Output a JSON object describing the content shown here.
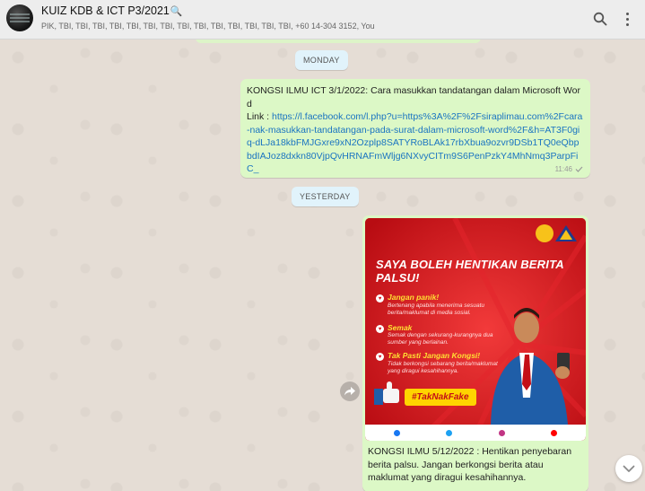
{
  "header": {
    "title": "KUIZ KDB & ICT P3/2021",
    "participants": "PIK, TBI, TBI, TBI, TBI, TBI, TBI, TBI, TBI, TBI, TBI, TBI, TBI, TBI, TBI, +60 14-304 3152, You"
  },
  "chat": {
    "date_monday": "MONDAY",
    "date_yesterday": "YESTERDAY",
    "message1": {
      "text": "KONGSI ILMU ICT 3/1/2022: Cara masukkan tandatangan dalam Microsoft Word",
      "link_prefix": "Link : ",
      "link": "https://l.facebook.com/l.php?u=https%3A%2F%2Fsiraplimau.com%2Fcara-nak-masukkan-tandatangan-pada-surat-dalam-microsoft-word%2F&h=AT3F0giq-dLJa18kbFMJGxre9xN2Ozplp8SATYRoBLAk17rbXbua9ozvr9DSb1TQ0eQbpbdIAJoz8dxkn80VjpQvHRNAFmWljg6NXvyCITm9S6PenPzkY4MhNmq3ParpFiC_",
      "time": "11:46"
    },
    "message2": {
      "caption": "KONGSI ILMU 5/12/2022 : Hentikan penyebaran berita palsu. Jangan berkongsi berita atau maklumat yang diragui kesahihannya.",
      "poster": {
        "title": "SAYA BOLEH HENTIKAN BERITA PALSU!",
        "item1_head": "Jangan panik!",
        "item1_body": "Bertenang apabila menerima sesuatu berita/maklumat di media sosial.",
        "item2_head": "Semak",
        "item2_body": "Semak dengan sekurang-kurangnya dua sumber yang berlainan.",
        "item3_head": "Tak Pasti Jangan Kongsi!",
        "item3_body": "Tidak berkongsi sebarang berita/maklumat yang diragui kesahihannya.",
        "hashtag": "#TakNakFake"
      }
    }
  },
  "colors": {
    "header_bg": "#ededed",
    "chat_bg": "#e5ddd5",
    "outgoing_bubble": "#dcf8c6",
    "date_chip": "#e1f3fb",
    "link": "#1a74c1",
    "poster_red": "#d7141c",
    "poster_yellow": "#ffd400"
  },
  "icons": {
    "search": "search-icon",
    "menu": "kebab-menu-icon",
    "forward": "forward-icon",
    "scroll": "chevron-down-icon",
    "tick": "single-tick-icon"
  }
}
